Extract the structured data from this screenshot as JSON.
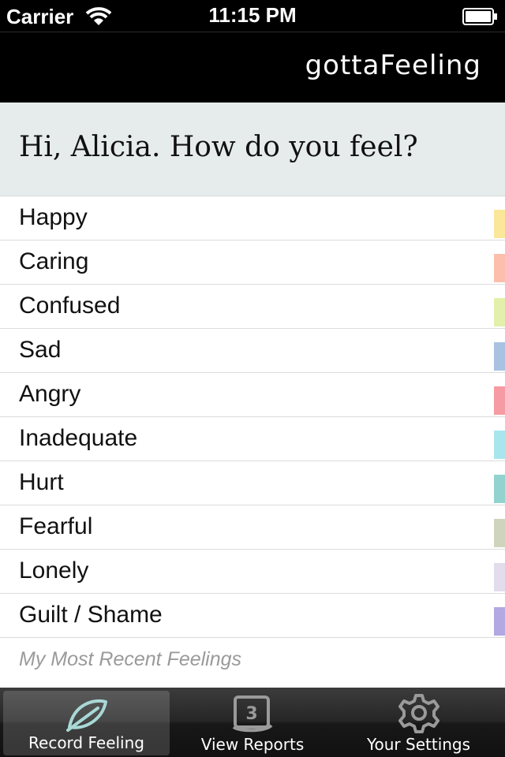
{
  "status_bar": {
    "carrier": "Carrier",
    "time": "11:15 PM"
  },
  "header": {
    "app_title": "gottaFeeling"
  },
  "greeting": "Hi, Alicia. How do you feel?",
  "feelings": [
    {
      "label": "Happy",
      "color": "#fbe79a"
    },
    {
      "label": "Caring",
      "color": "#fcbfab"
    },
    {
      "label": "Confused",
      "color": "#e3f0ab"
    },
    {
      "label": "Sad",
      "color": "#a9c2e2"
    },
    {
      "label": "Angry",
      "color": "#f69aa3"
    },
    {
      "label": "Inadequate",
      "color": "#a8e6ee"
    },
    {
      "label": "Hurt",
      "color": "#93d3cf"
    },
    {
      "label": "Fearful",
      "color": "#cfd4bc"
    },
    {
      "label": "Lonely",
      "color": "#e3dcec"
    },
    {
      "label": "Guilt / Shame",
      "color": "#b2a8e2"
    }
  ],
  "recent_label": "My Most Recent Feelings",
  "tabs": [
    {
      "label": "Record Feeling",
      "icon": "leaf-icon",
      "active": true
    },
    {
      "label": "View Reports",
      "icon": "calendar-icon",
      "badge": "3",
      "active": false
    },
    {
      "label": "Your Settings",
      "icon": "gear-icon",
      "active": false
    }
  ]
}
